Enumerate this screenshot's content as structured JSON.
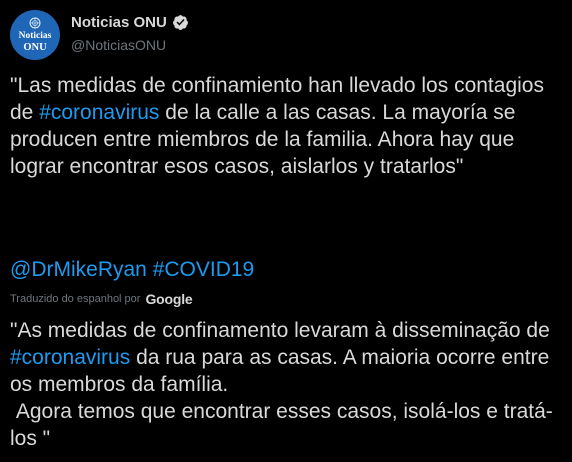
{
  "author": {
    "display_name": "Noticias ONU",
    "handle": "@NoticiasONU",
    "avatar_line1": "Noticias",
    "avatar_line2": "ONU",
    "avatar_icon": "un-emblem-icon",
    "verified_icon": "verified-badge-icon"
  },
  "tweet": {
    "text_part1": "\"Las medidas de confinamiento han llevado los contagios de ",
    "hashtag1": "#coronavirus",
    "text_part2": " de la calle a las casas. La mayoría se producen entre miembros de la familia. Ahora hay que lograr encontrar esos casos, aislarlos y tratarlos\"",
    "mention": "@DrMikeRyan",
    "hashtag2": "#COVID19"
  },
  "translation": {
    "label": "Traduzido do espanhol por",
    "provider": "Google",
    "text_part1": "\"As medidas de confinamento levaram à disseminação de ",
    "hashtag": "#coronavirus",
    "text_part2": " da rua para as casas. A maioria ocorre entre os membros da família.\n Agora temos que encontrar esses casos, isolá-los e tratá-los \""
  },
  "colors": {
    "background": "#000000",
    "text": "#d9d9d9",
    "secondary": "#6e767d",
    "link": "#1d9bf0",
    "avatar_bg": "#1f67b6"
  }
}
